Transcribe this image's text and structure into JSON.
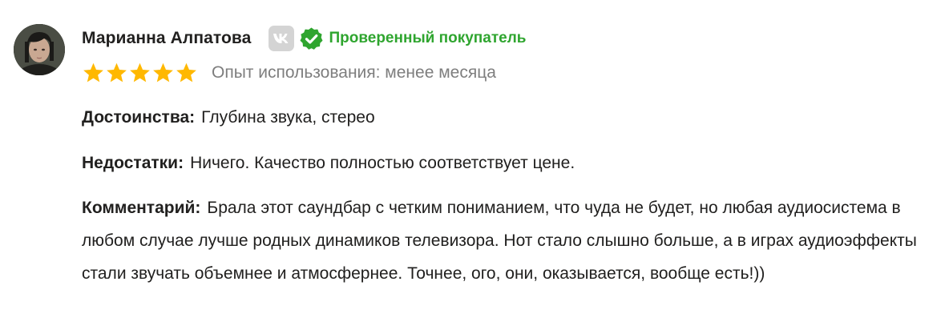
{
  "author": {
    "name": "Марианна Алпатова",
    "verified_label": "Проверенный покупатель"
  },
  "rating": {
    "stars": 5,
    "max": 5,
    "experience": "Опыт использования: менее месяца"
  },
  "pros": {
    "label": "Достоинства:",
    "text": "Глубина звука, стерео"
  },
  "cons": {
    "label": "Недостатки:",
    "text": "Ничего. Качество полностью соответствует цене."
  },
  "comment": {
    "label": "Комментарий:",
    "text": "Брала этот саундбар с четким пониманием, что чуда не будет, но любая аудиосистема в любом случае лучше родных динамиков телевизора. Нот стало слышно больше, а в играх аудиоэффекты стали звучать объемнее и атмосфернее. Точнее, ого, они, оказывается, вообще есть!))"
  },
  "colors": {
    "star": "#ffb800",
    "verified": "#2fa52f",
    "vk_badge": "#d4d4d4"
  },
  "icons": [
    "avatar",
    "vk-icon",
    "verified-check-icon",
    "star-icon"
  ]
}
